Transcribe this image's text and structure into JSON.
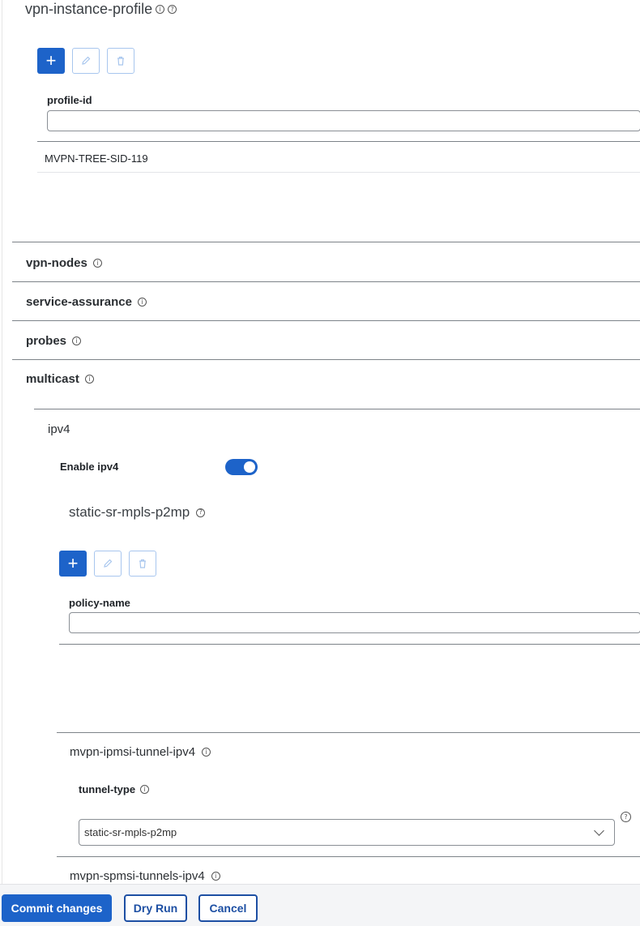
{
  "vpn_instance_profile": {
    "title": "vpn-instance-profile",
    "column_label": "profile-id",
    "filter_value": "",
    "rows": [
      {
        "profile_id": "MVPN-TREE-SID-119"
      }
    ]
  },
  "sections": {
    "vpn_nodes": "vpn-nodes",
    "service_assurance": "service-assurance",
    "probes": "probes",
    "multicast": "multicast"
  },
  "ipv4": {
    "title": "ipv4",
    "enable_label": "Enable ipv4",
    "enabled": true,
    "static_sr": {
      "title": "static-sr-mpls-p2mp",
      "column_label": "policy-name",
      "filter_value": ""
    },
    "ipmsi": {
      "title": "mvpn-ipmsi-tunnel-ipv4",
      "tunnel_type_label": "tunnel-type",
      "tunnel_type_value": "static-sr-mpls-p2mp"
    },
    "spmsi": {
      "title": "mvpn-spmsi-tunnels-ipv4"
    }
  },
  "footer": {
    "commit_label": "Commit changes",
    "dry_run_label": "Dry Run",
    "cancel_label": "Cancel"
  },
  "colors": {
    "primary": "#1d63c9",
    "rule": "#7d8389"
  },
  "icons": [
    "info-icon",
    "help-icon",
    "plus-icon",
    "pencil-icon",
    "trash-icon",
    "chevron-down-icon"
  ]
}
